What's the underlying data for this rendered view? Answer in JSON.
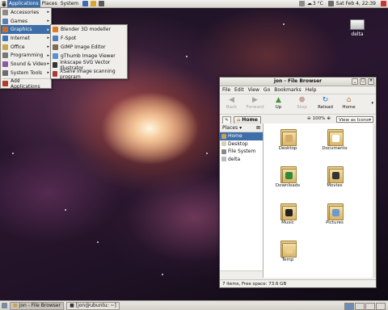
{
  "top_panel": {
    "menus": [
      "Applications",
      "Places",
      "System"
    ],
    "weather": "3 °C",
    "clock": "Sat Feb  4, 22:39"
  },
  "apps_menu": {
    "items": [
      {
        "label": "Accessories",
        "icon": "accessories-icon",
        "color": "#8a8a8a",
        "has_sub": true
      },
      {
        "label": "Games",
        "icon": "games-icon",
        "color": "#5d7fb0",
        "has_sub": true
      },
      {
        "label": "Graphics",
        "icon": "graphics-icon",
        "color": "#c96f2d",
        "has_sub": true
      },
      {
        "label": "Internet",
        "icon": "internet-icon",
        "color": "#3f73b7",
        "has_sub": true
      },
      {
        "label": "Office",
        "icon": "office-icon",
        "color": "#c8a64b",
        "has_sub": true
      },
      {
        "label": "Programming",
        "icon": "programming-icon",
        "color": "#777777",
        "has_sub": true
      },
      {
        "label": "Sound & Video",
        "icon": "sound-video-icon",
        "color": "#8a5aa0",
        "has_sub": true
      },
      {
        "label": "System Tools",
        "icon": "system-tools-icon",
        "color": "#6c6c6c",
        "has_sub": true
      }
    ],
    "footer_item": {
      "label": "Add Applications",
      "icon": "add-applications-icon",
      "color": "#b33a2e"
    },
    "selected": "Graphics"
  },
  "graphics_menu": {
    "items": [
      {
        "label": "Blender 3D modeller",
        "icon": "blender-icon",
        "color": "#e07a24"
      },
      {
        "label": "F-Spot",
        "icon": "f-spot-icon",
        "color": "#4b7fc0"
      },
      {
        "label": "GIMP Image Editor",
        "icon": "gimp-icon",
        "color": "#7d6b55"
      },
      {
        "label": "gThumb Image Viewer",
        "icon": "gthumb-icon",
        "color": "#5b8fd0"
      },
      {
        "label": "Inkscape SVG Vector Illustrator",
        "icon": "inkscape-icon",
        "color": "#333333"
      },
      {
        "label": "XSane image scanning program",
        "icon": "xsane-icon",
        "color": "#a73a3a"
      }
    ]
  },
  "desktop_icons": [
    {
      "label": "delta",
      "icon": "drive-icon"
    }
  ],
  "window": {
    "title": "jon - File Browser",
    "menu": [
      "File",
      "Edit",
      "View",
      "Go",
      "Bookmarks",
      "Help"
    ],
    "toolbar": [
      {
        "label": "Back",
        "icon": "back-arrow-icon",
        "enabled": false,
        "color": "#a9a59d"
      },
      {
        "label": "Forward",
        "icon": "forward-arrow-icon",
        "enabled": false,
        "color": "#a9a59d"
      },
      {
        "label": "Up",
        "icon": "up-arrow-icon",
        "enabled": true,
        "color": "#3f9a2e"
      },
      {
        "label": "Stop",
        "icon": "stop-icon",
        "enabled": false,
        "color": "#c9a7a1"
      },
      {
        "label": "Reload",
        "icon": "reload-icon",
        "enabled": true,
        "color": "#2f6fb5"
      },
      {
        "label": "Home",
        "icon": "home-icon",
        "enabled": true,
        "color": "#b77b3b"
      }
    ],
    "location": {
      "button": "Home",
      "zoom": "100%",
      "view": "View as Icons"
    },
    "places_label": "Places",
    "places": [
      {
        "label": "Home",
        "icon": "home-folder-icon",
        "selected": true
      },
      {
        "label": "Desktop",
        "icon": "desktop-folder-icon",
        "selected": false
      },
      {
        "label": "File System",
        "icon": "filesystem-icon",
        "selected": false
      },
      {
        "label": "delta",
        "icon": "drive-icon",
        "selected": false
      }
    ],
    "files": [
      {
        "label": "Desktop",
        "icon": "desktop-folder-icon",
        "emblem": "#d4a96a"
      },
      {
        "label": "Documents",
        "icon": "documents-folder-icon",
        "emblem": "#ffffff"
      },
      {
        "label": "Downloads",
        "icon": "downloads-folder-icon",
        "emblem": "#2f8a3b"
      },
      {
        "label": "Movies",
        "icon": "movies-folder-icon",
        "emblem": "#333333"
      },
      {
        "label": "Music",
        "icon": "music-folder-icon",
        "emblem": "#222222"
      },
      {
        "label": "Pictures",
        "icon": "pictures-folder-icon",
        "emblem": "#6a9ad0"
      },
      {
        "label": "Temp",
        "icon": "temp-folder-icon",
        "emblem": "#ead18f"
      }
    ],
    "status": "7 items, Free space: 73.6 GB"
  },
  "bottom_panel": {
    "tasks": [
      {
        "label": "jon - File Browser",
        "active": true
      },
      {
        "label": "[jon@ubuntu: ~]",
        "active": false
      }
    ]
  },
  "colors": {
    "selection": "#3e6ea8",
    "panel": "#dcd9d2"
  }
}
